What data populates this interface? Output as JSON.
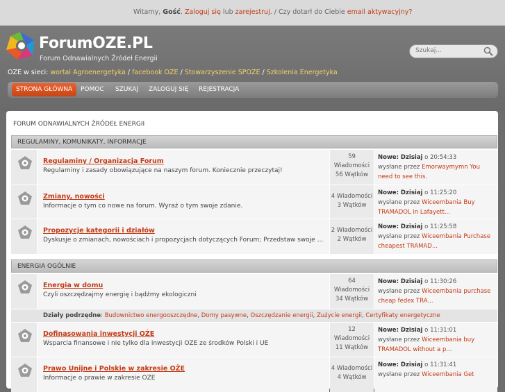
{
  "topbar": {
    "greeting": "Witamy, ",
    "guest": "Gość",
    "sep1": ". ",
    "login": "Zaloguj się",
    "or": " lub ",
    "register": "zarejestruj",
    "sep2": ". / Czy dotarł do Ciebie ",
    "activation": "email aktywacyjny?"
  },
  "logo": {
    "title": "ForumOZE.PL",
    "subtitle": "Forum Odnawialnych Źródeł Energii"
  },
  "search": {
    "placeholder": "Szukaj..."
  },
  "network": {
    "label": "OZE w sieci: ",
    "links": [
      "wortal Agroenergetyka",
      "facebook OZE",
      "Stowarzyszenie SPOZE",
      "Szkolenia Energetyka"
    ],
    "sep": " / "
  },
  "nav": {
    "items": [
      "STRONA GŁÓWNA",
      "POMOC",
      "SZUKAJ",
      "ZALOGUJ SIĘ",
      "REJESTRACJA"
    ]
  },
  "forum_title": "FORUM ODNAWIALNYCH ŹRÓDEŁ ENERGII",
  "categories": [
    {
      "name": "REGULAMINY, KOMUNIKATY, INFORMACJE",
      "boards": [
        {
          "name": "Regulaminy / Organizacja Forum",
          "desc": "Regulaminy i zasady obowiązujące na naszym forum. Koniecznie przeczytaj!",
          "stats": [
            "59",
            "Wiadomości",
            "56 Wątków"
          ],
          "last_date": "Nowe: Dzisiaj",
          "last_time": " o 20:54:33",
          "by": "wysłane przez ",
          "last_post": "Emorwaymymn You need to see this."
        },
        {
          "name": "Zmiany, nowości",
          "desc": "Informacje o tym co nowe na forum. Wyraź o tym swoje zdanie.",
          "stats": [
            "4 Wiadomości",
            "3 Wątków"
          ],
          "last_date": "Nowe: Dzisiaj",
          "last_time": " o 11:25:20",
          "by": "wysłane przez ",
          "last_post": "Wiceembania Buy TRAMADOL in Lafayett..."
        },
        {
          "name": "Propozycje kategorii i działów",
          "desc": "Dyskusje o zmianach, nowościach i propozycjach dotyczących Forum; Przedstaw swoje pomysły...",
          "stats": [
            "2 Wiadomości",
            "2 Wątków"
          ],
          "last_date": "Nowe: Dzisiaj",
          "last_time": " o 11:25:58",
          "by": "wysłane przez ",
          "last_post": "Wiceembania Purchase cheapest TRAMAD..."
        }
      ]
    },
    {
      "name": "ENERGIA OGÓLNIE",
      "boards": [
        {
          "name": "Energia w domu",
          "desc": "Czyli oszczędzajmy energię i bądźmy ekologiczni",
          "stats": [
            "64",
            "Wiadomości",
            "34 Wątków"
          ],
          "last_date": "Nowe: Dzisiaj",
          "last_time": " o 11:30:26",
          "by": "wysłane przez ",
          "last_post": "Wiceembania purchase cheap fedex TRA..."
        },
        {
          "name": "Dofinasowania inwestycji OŻE",
          "desc": "Wsparcia finansowe i nie tylko dla inwestycji OŻE ze środków Polski i UE",
          "stats": [
            "12",
            "Wiadomości",
            "11 Wątków"
          ],
          "last_date": "Nowe: Dzisiaj",
          "last_time": " o 11:31:01",
          "by": "wysłane przez ",
          "last_post": "Wiceembania buy TRAMADOL without a p..."
        },
        {
          "name": "Prawo Unijne i Polskie w zakresie OŻE",
          "desc": "Informacje o prawie w zakresie OŻE",
          "stats": [
            "4 Wiadomości",
            "4 Wątków"
          ],
          "last_date": "Nowe: Dzisiaj",
          "last_time": " o 11:31:41",
          "by": "wysłane przez ",
          "last_post": "Wiceembania Get"
        }
      ],
      "subboards_label": "Działy podrzędne",
      "subboards": [
        "Budownictwo energooszczędne",
        "Domy pasywne",
        "Oszczędzanie energii",
        "Zużycie energii",
        "Certyfikaty energetyczne"
      ]
    }
  ],
  "colors": {
    "accent": "#c23a15",
    "nav_active": "#d9521f",
    "header_bg": "#707070"
  }
}
